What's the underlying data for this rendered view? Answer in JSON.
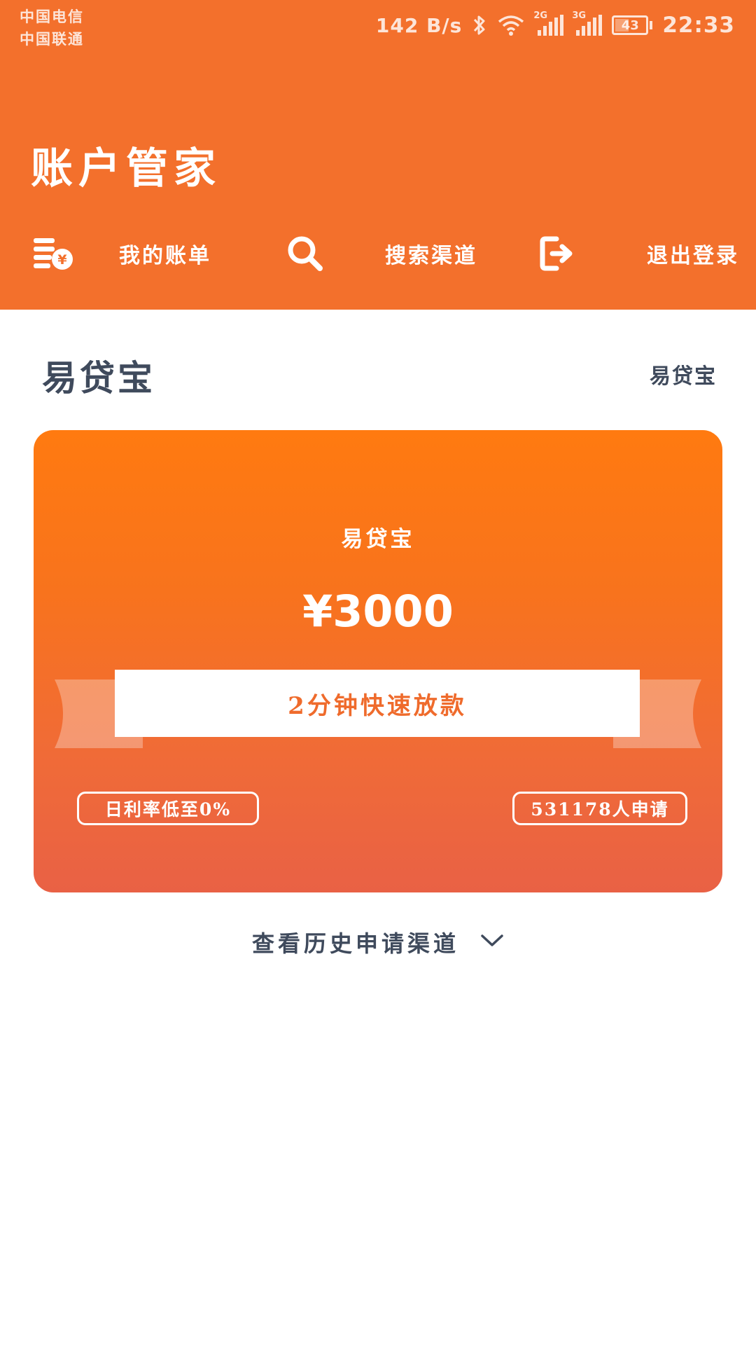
{
  "status_bar": {
    "carrier_1": "中国电信",
    "carrier_2": "中国联通",
    "net_speed": "142 B/s",
    "sim1_type": "2G",
    "sim2_type": "3G",
    "battery": "43",
    "time": "22:33"
  },
  "header": {
    "title": "账户管家",
    "nav": [
      {
        "label": "我的账单",
        "icon": "bill-icon"
      },
      {
        "label": "搜索渠道",
        "icon": "search-icon"
      },
      {
        "label": "退出登录",
        "icon": "logout-icon"
      }
    ]
  },
  "section": {
    "title": "易贷宝",
    "link": "易贷宝"
  },
  "card": {
    "name": "易贷宝",
    "amount": "¥3000",
    "ribbon": "2分钟快速放款",
    "rate_tag": "日利率低至0%",
    "applicants_tag": "531178人申请"
  },
  "history": {
    "label": "查看历史申请渠道",
    "icon": "chevron-down-icon"
  },
  "colors": {
    "header_bg": "#f3702c",
    "card_top": "#ff7a10",
    "card_bottom": "#e96145",
    "text_dark": "#3f4a5c"
  }
}
